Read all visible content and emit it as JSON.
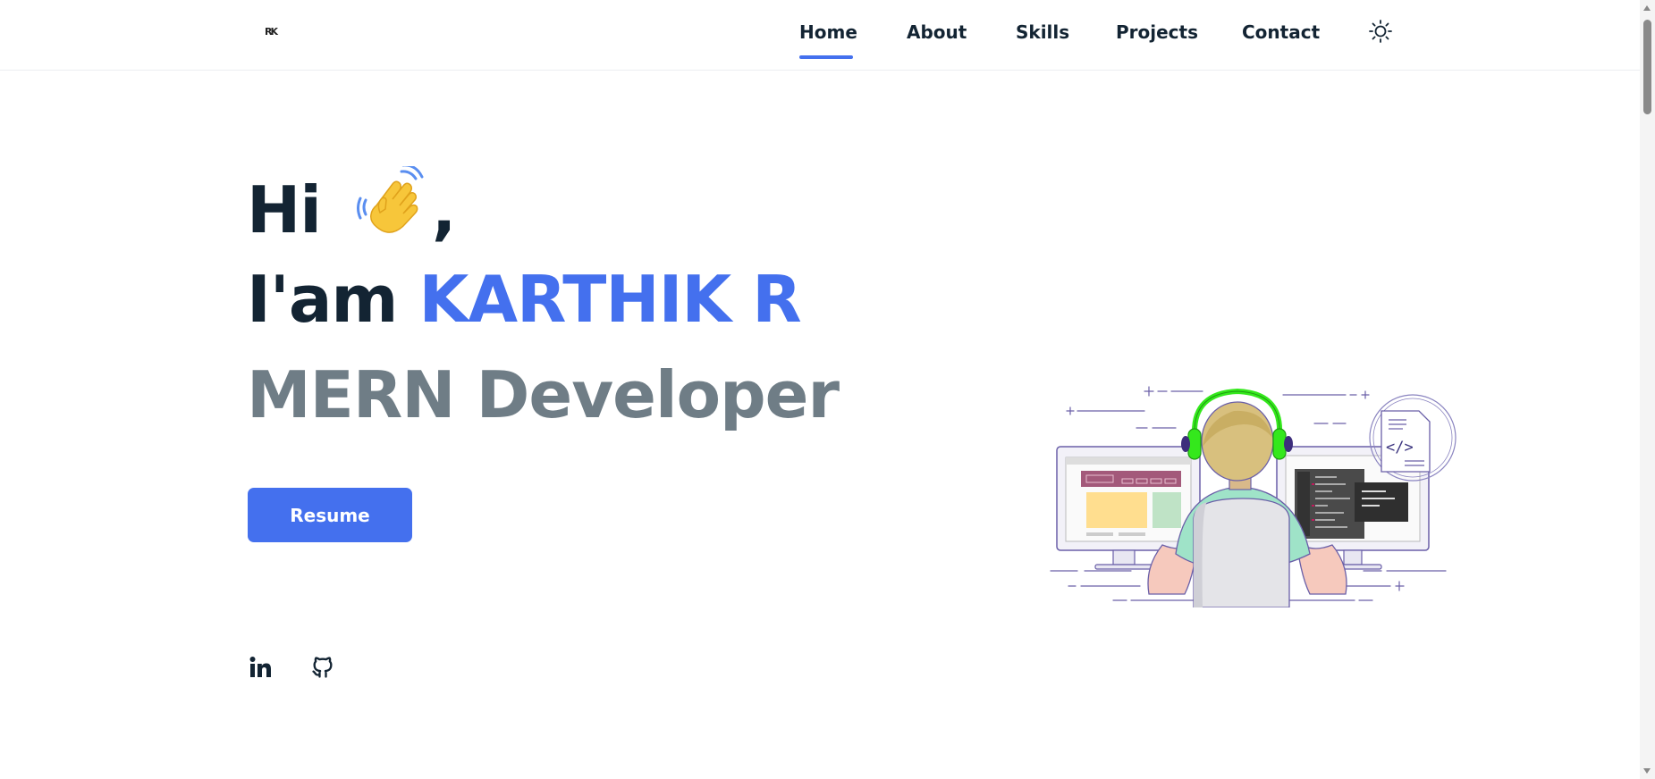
{
  "header": {
    "logo_text": "RK",
    "nav": {
      "home": "Home",
      "about": "About",
      "skills": "Skills",
      "projects": "Projects",
      "contact": "Contact"
    },
    "active_item": "Home",
    "theme_icon": "sun-icon"
  },
  "hero": {
    "greeting": "Hi",
    "greeting_icon": "waving-hand-icon",
    "greeting_comma": ",",
    "intro_prefix": "I'am",
    "name": "KARTHIK R",
    "role": "MERN Developer",
    "resume_label": "Resume",
    "social_icons": [
      "linkedin-icon",
      "github-icon"
    ]
  },
  "colors": {
    "accent": "#4470ee",
    "heading": "#132433",
    "muted": "#6f7d86",
    "headphones": "#34e81c"
  }
}
